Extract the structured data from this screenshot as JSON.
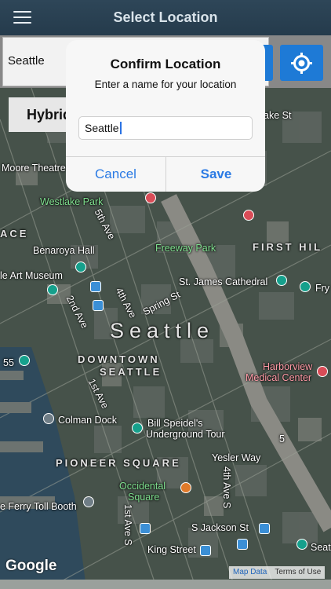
{
  "nav": {
    "title": "Select Location"
  },
  "search": {
    "value": "Seattle"
  },
  "map": {
    "type_button": "Hybrid",
    "watermark": "Google",
    "attribution": {
      "map_data": "Map Data",
      "terms": "Terms of Use"
    },
    "labels": {
      "moore_theatre": "Moore Theatre",
      "westlake_park": "Westlake Park",
      "ace": "ACE",
      "benaroya_hall": "Benaroya Hall",
      "art_museum": "le Art Museum",
      "freeway_park": "Freeway Park",
      "first_hill": "FIRST HIL",
      "st_james": "St. James Cathedral",
      "fry": "Fry",
      "fifth_ave": "5th Ave",
      "fourth_ave": "4th Ave",
      "second_ave": "2nd Ave",
      "spring_st": "Spring St",
      "seattle": "Seattle",
      "downtown": "DOWNTOWN",
      "seattle_district": "SEATTLE",
      "first_ave": "1st Ave",
      "harborview": "Harborview",
      "medical_center": "Medical Center",
      "hwy55": "55",
      "colman_dock": "Colman Dock",
      "bill_speidel_1": "Bill Speidel's",
      "bill_speidel_2": "Underground Tour",
      "pioneer_square": "PIONEER SQUARE",
      "yesler_way": "Yesler Way",
      "occidental_1": "Occidental",
      "occidental_2": "Square",
      "fourth_ave_s": "4th Ave S",
      "ferry_toll": "e Ferry Toll Booth",
      "first_ave_s": "1st Ave S",
      "s_jackson": "S Jackson St",
      "king_street": "King Street",
      "seat": "Seat",
      "hwy5": "5",
      "ake_st": "ake St"
    }
  },
  "dialog": {
    "title": "Confirm Location",
    "message": "Enter a name for your location",
    "input_value": "Seattle",
    "cancel_label": "Cancel",
    "save_label": "Save"
  },
  "colors": {
    "navbar": "#2a4254",
    "accent": "#1e7ad6",
    "dialog_button": "#2a7ae4"
  }
}
